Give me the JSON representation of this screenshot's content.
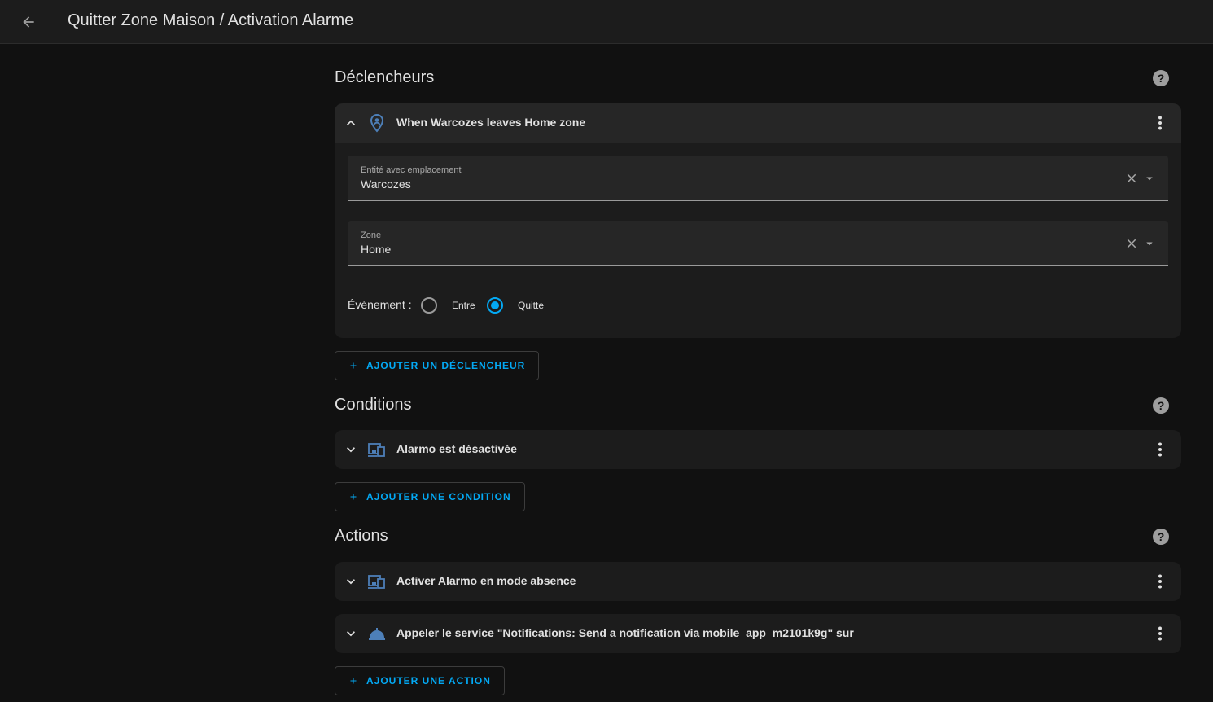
{
  "header": {
    "title": "Quitter Zone Maison / Activation Alarme"
  },
  "triggers": {
    "title": "Déclencheurs",
    "items": [
      {
        "title": "When Warcozes leaves Home zone",
        "entity_label": "Entité avec emplacement",
        "entity_value": "Warcozes",
        "zone_label": "Zone",
        "zone_value": "Home",
        "event_label": "Événement :",
        "event_options": [
          {
            "label": "Entre",
            "checked": false
          },
          {
            "label": "Quitte",
            "checked": true
          }
        ]
      }
    ],
    "add_label": "AJOUTER UN DÉCLENCHEUR"
  },
  "conditions": {
    "title": "Conditions",
    "items": [
      {
        "title": "Alarmo est désactivée"
      }
    ],
    "add_label": "AJOUTER UNE CONDITION"
  },
  "actions": {
    "title": "Actions",
    "items": [
      {
        "title": "Activer Alarmo en mode absence"
      },
      {
        "title": "Appeler le service \"Notifications: Send a notification via mobile_app_m2101k9g\" sur"
      }
    ],
    "add_label": "AJOUTER UNE ACTION"
  },
  "colors": {
    "accent": "#03a9f4",
    "background": "#111111",
    "card": "#1c1c1c",
    "icon": "#4d7fb8"
  }
}
